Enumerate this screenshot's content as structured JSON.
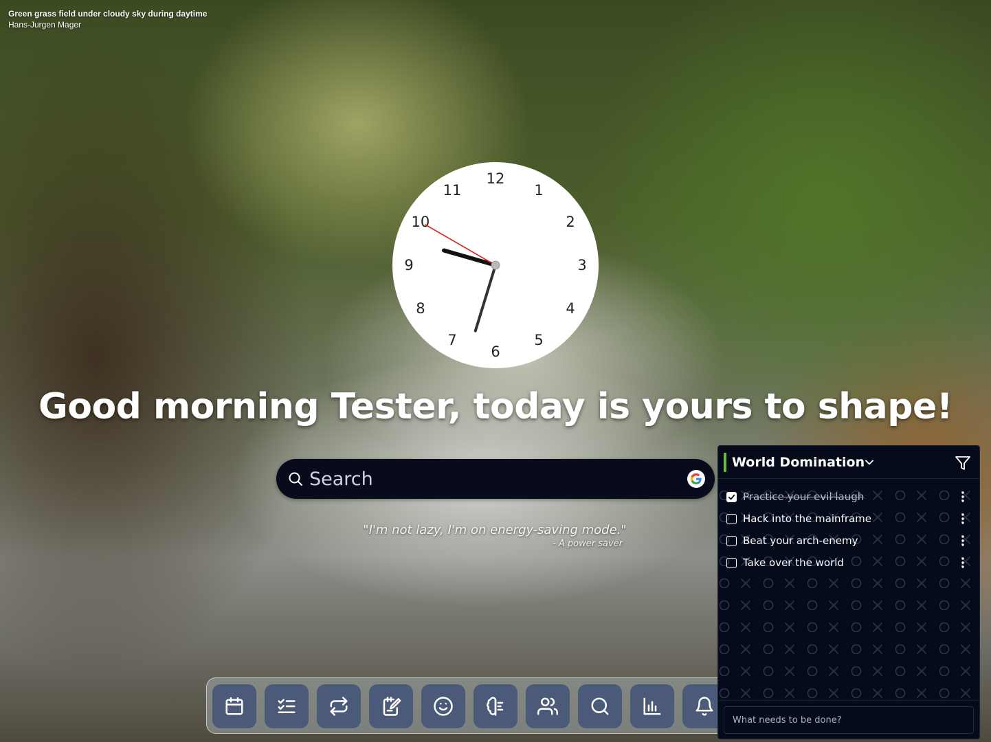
{
  "photo": {
    "title": "Green grass field under cloudy sky during daytime",
    "author": "Hans-Jurgen Mager"
  },
  "clock": {
    "numbers": [
      "12",
      "1",
      "2",
      "3",
      "4",
      "5",
      "6",
      "7",
      "8",
      "9",
      "10",
      "11"
    ],
    "time": {
      "hours": 9,
      "minutes": 32,
      "seconds": 50
    },
    "second_hand_color": "#e11d1d"
  },
  "greeting": "Good morning Tester, today is yours to shape!",
  "search": {
    "placeholder": "Search",
    "engine_icon": "google-icon"
  },
  "quote": {
    "text": "\"I'm not lazy, I'm on energy-saving mode.\"",
    "author": "- A power saver"
  },
  "dock": {
    "items": [
      {
        "icon": "calendar-icon"
      },
      {
        "icon": "checklist-icon"
      },
      {
        "icon": "repeat-icon"
      },
      {
        "icon": "notepad-icon"
      },
      {
        "icon": "smiley-icon"
      },
      {
        "icon": "brain-icon"
      },
      {
        "icon": "users-icon"
      },
      {
        "icon": "search-icon"
      },
      {
        "icon": "bar-chart-icon"
      },
      {
        "icon": "bell-icon"
      }
    ]
  },
  "todo": {
    "list_title": "World Domination",
    "accent_color": "#6abf3a",
    "tasks": [
      {
        "label": "Practice your evil laugh",
        "done": true
      },
      {
        "label": "Hack into the mainframe",
        "done": false
      },
      {
        "label": "Beat your arch-enemy",
        "done": false
      },
      {
        "label": "Take over the world",
        "done": false
      }
    ],
    "new_task_placeholder": "What needs to be done?"
  }
}
